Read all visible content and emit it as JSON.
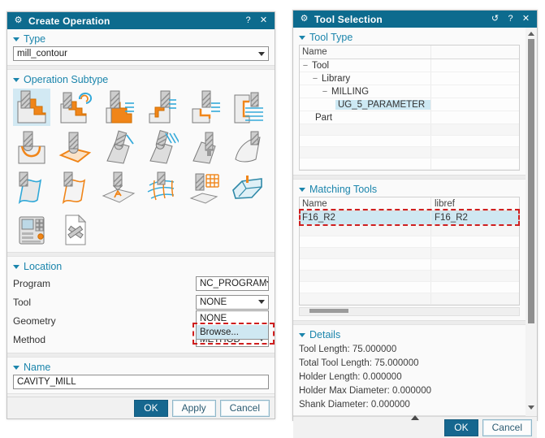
{
  "colors": {
    "titlebar": "#0d6b8e",
    "accent": "#1b85ac",
    "highlight": "#cfe8f2",
    "marker_red": "#cf1f1f",
    "ok_blue": "#16678f",
    "orange": "#f08519",
    "tool_blue": "#35aada"
  },
  "left_dialog": {
    "title": "Create Operation",
    "titlebar": {
      "help_glyph": "?",
      "close_glyph": "✕"
    },
    "type_section": {
      "label": "Type",
      "value": "mill_contour"
    },
    "operation_subtype": {
      "label": "Operation Subtype",
      "selected_index": 0,
      "icons": [
        "cavity-mill",
        "adaptive-milling",
        "plunge-milling",
        "corner-rough",
        "rest-milling",
        "zlevel-profile",
        "zlevel-corner",
        "fixed-contour",
        "contour-area",
        "contour-surface-area",
        "contour-area-directional",
        "flowcut-single",
        "profile-3d-curve",
        "contour-profile",
        "contour-text",
        "streamline",
        "surface-area-grid",
        "solid-profile-3d",
        "mill-control",
        "mill-user"
      ]
    },
    "location_section": {
      "label": "Location",
      "rows": [
        {
          "label": "Program",
          "value": "NC_PROGRAM"
        },
        {
          "label": "Tool",
          "value": "NONE"
        },
        {
          "label": "Geometry",
          "value": ""
        },
        {
          "label": "Method",
          "value": "METHOD"
        }
      ]
    },
    "tool_dropdown": {
      "items": [
        "NONE",
        "Browse..."
      ],
      "highlighted_index": 1
    },
    "name_section": {
      "label": "Name",
      "value": "CAVITY_MILL"
    },
    "footer": {
      "ok": "OK",
      "apply": "Apply",
      "cancel": "Cancel"
    }
  },
  "right_dialog": {
    "title": "Tool Selection",
    "titlebar": {
      "reset_glyph": "↺",
      "help_glyph": "?",
      "close_glyph": "✕"
    },
    "tool_type_section": {
      "label": "Tool Type",
      "column": "Name",
      "rows": [
        {
          "label": "Tool",
          "expander": "−"
        },
        {
          "label": "Library",
          "expander": "−"
        },
        {
          "label": "MILLING",
          "expander": "−"
        },
        {
          "label": "UG_5_PARAMETER",
          "expander": ""
        },
        {
          "label": "Part",
          "expander": ""
        }
      ]
    },
    "matching_tools_section": {
      "label": "Matching Tools",
      "columns": {
        "name": "Name",
        "libref": "libref"
      },
      "rows": [
        {
          "name": "F16_R2",
          "libref": "F16_R2"
        }
      ]
    },
    "details_section": {
      "label": "Details",
      "lines": [
        "Tool Length: 75.000000",
        "Total Tool Length: 75.000000",
        "Holder Length: 0.000000",
        "Holder Max Diameter: 0.000000",
        "Shank Diameter: 0.000000"
      ]
    },
    "footer": {
      "ok": "OK",
      "cancel": "Cancel"
    }
  }
}
